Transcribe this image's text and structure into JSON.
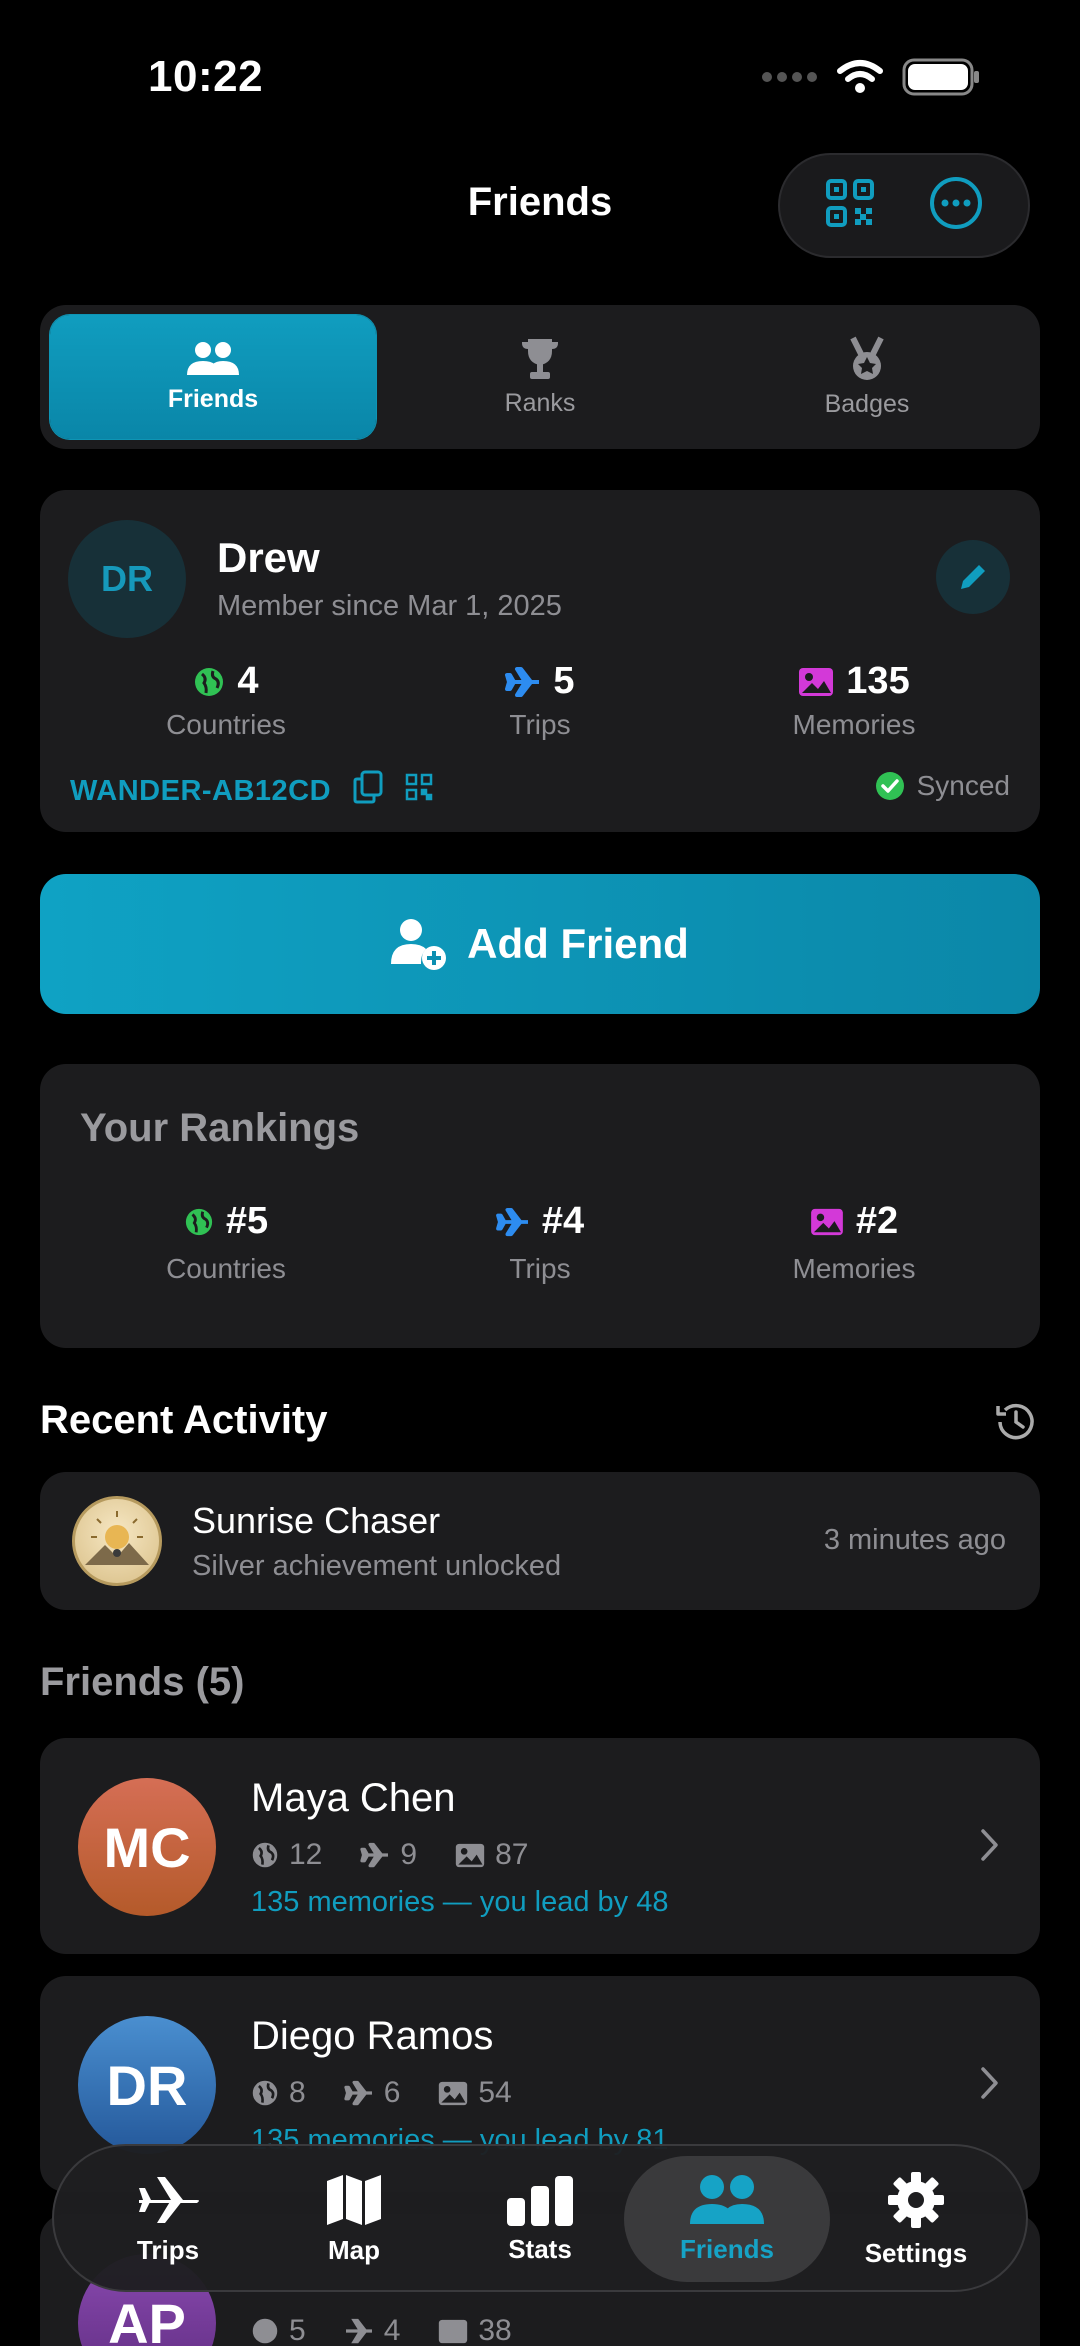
{
  "status": {
    "time": "10:22"
  },
  "header": {
    "title": "Friends"
  },
  "segments": [
    {
      "label": "Friends",
      "icon": "people-icon",
      "active": true
    },
    {
      "label": "Ranks",
      "icon": "trophy-icon",
      "active": false
    },
    {
      "label": "Badges",
      "icon": "medal-icon",
      "active": false
    }
  ],
  "profile": {
    "initials": "DR",
    "name": "Drew",
    "since": "Member since Mar 1, 2025",
    "stats": [
      {
        "value": "4",
        "label": "Countries",
        "icon": "globe-icon"
      },
      {
        "value": "5",
        "label": "Trips",
        "icon": "airplane-icon"
      },
      {
        "value": "135",
        "label": "Memories",
        "icon": "photo-icon"
      }
    ],
    "code": "WANDER-AB12CD",
    "sync_status": "Synced"
  },
  "add_friend": {
    "label": "Add Friend"
  },
  "rankings": {
    "title": "Your Rankings",
    "items": [
      {
        "value": "#5",
        "label": "Countries"
      },
      {
        "value": "#4",
        "label": "Trips"
      },
      {
        "value": "#2",
        "label": "Memories"
      }
    ]
  },
  "recent_activity": {
    "title": "Recent Activity",
    "items": [
      {
        "title": "Sunrise Chaser",
        "subtitle": "Silver achievement unlocked",
        "time": "3 minutes ago"
      }
    ]
  },
  "friends": {
    "title": "Friends (5)",
    "items": [
      {
        "initials": "MC",
        "name": "Maya Chen",
        "countries": "12",
        "trips": "9",
        "memories": "87",
        "lead": "135 memories — you lead by 48",
        "color": "#c9633f"
      },
      {
        "initials": "DR",
        "name": "Diego Ramos",
        "countries": "8",
        "trips": "6",
        "memories": "54",
        "lead": "135 memories — you lead by 81",
        "color": "#2f74b6"
      },
      {
        "initials": "AP",
        "name": "",
        "countries": "5",
        "trips": "4",
        "memories": "38",
        "lead": "",
        "color": "#7a3fa0"
      }
    ]
  },
  "tabbar": [
    {
      "label": "Trips",
      "icon": "airplane-icon"
    },
    {
      "label": "Map",
      "icon": "map-icon"
    },
    {
      "label": "Stats",
      "icon": "chart-icon"
    },
    {
      "label": "Friends",
      "icon": "people-icon",
      "active": true
    },
    {
      "label": "Settings",
      "icon": "gear-icon"
    }
  ],
  "colors": {
    "accent": "#109dbf",
    "background": "#000000",
    "card": "#1c1c1e"
  }
}
